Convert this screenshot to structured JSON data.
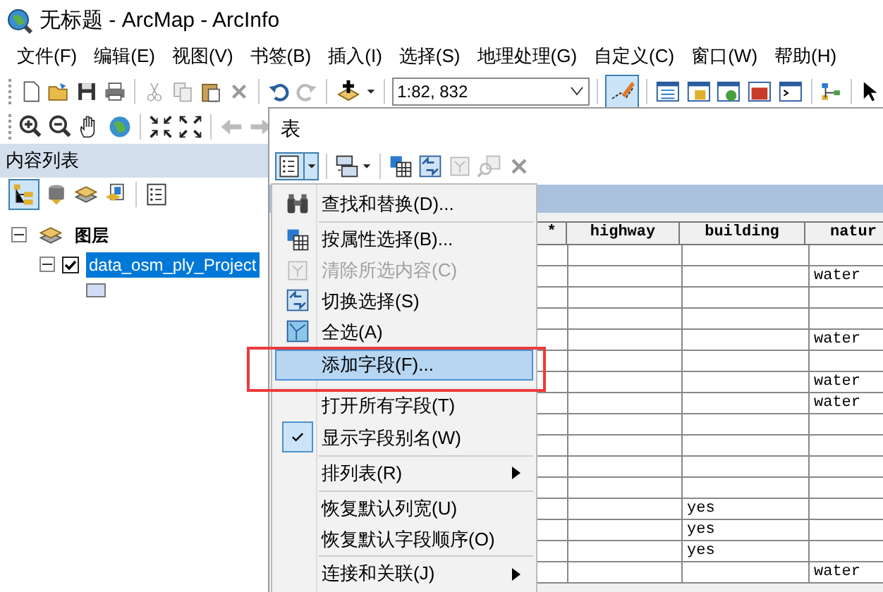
{
  "window": {
    "title": "无标题 - ArcMap - ArcInfo"
  },
  "menu_bar": [
    "文件(F)",
    "编辑(E)",
    "视图(V)",
    "书签(B)",
    "插入(I)",
    "选择(S)",
    "地理处理(G)",
    "自定义(C)",
    "窗口(W)",
    "帮助(H)"
  ],
  "toolbar": {
    "scale": "1:82, 832"
  },
  "table_of_contents": {
    "title": "内容列表",
    "tree": [
      {
        "label": "图层",
        "expanded": true,
        "children": [
          {
            "label": "data_osm_ply_Project",
            "checked": true,
            "selected": true,
            "expanded": true
          }
        ]
      }
    ]
  },
  "table_window": {
    "title": "表",
    "columns": [
      "*",
      "highway",
      "building",
      "natur"
    ],
    "rows": [
      {
        "cells": [
          null,
          null,
          null,
          null
        ]
      },
      {
        "cells": [
          null,
          null,
          null,
          "water"
        ]
      },
      {
        "cells": [
          null,
          null,
          null,
          null
        ]
      },
      {
        "cells": [
          null,
          null,
          null,
          null
        ]
      },
      {
        "cells": [
          null,
          null,
          null,
          "water"
        ]
      },
      {
        "cells": [
          null,
          null,
          null,
          null
        ]
      },
      {
        "cells": [
          null,
          null,
          null,
          "water"
        ]
      },
      {
        "cells": [
          null,
          null,
          null,
          "water"
        ]
      },
      {
        "cells": [
          null,
          null,
          null,
          null
        ]
      },
      {
        "cells": [
          null,
          null,
          null,
          null
        ]
      },
      {
        "cells": [
          null,
          null,
          null,
          null
        ]
      },
      {
        "cells": [
          null,
          null,
          null,
          null
        ]
      },
      {
        "cells": [
          null,
          null,
          "yes",
          null
        ]
      },
      {
        "cells": [
          null,
          null,
          "yes",
          null
        ]
      },
      {
        "cells": [
          null,
          null,
          "yes",
          null
        ]
      },
      {
        "cells": [
          null,
          null,
          null,
          "water"
        ]
      }
    ]
  },
  "context_menu": [
    {
      "kind": "item",
      "label": "查找和替换(D)...",
      "disabled": false,
      "checked": false,
      "submenu": false,
      "selected": false
    },
    {
      "kind": "separator"
    },
    {
      "kind": "item",
      "label": "按属性选择(B)...",
      "disabled": false,
      "checked": false,
      "submenu": false,
      "selected": false
    },
    {
      "kind": "item",
      "label": "清除所选内容(C)",
      "disabled": true,
      "checked": false,
      "submenu": false,
      "selected": false
    },
    {
      "kind": "item",
      "label": "切换选择(S)",
      "disabled": false,
      "checked": false,
      "submenu": false,
      "selected": false
    },
    {
      "kind": "item",
      "label": "全选(A)",
      "disabled": false,
      "checked": false,
      "submenu": false,
      "selected": false
    },
    {
      "kind": "item",
      "label": "添加字段(F)...",
      "disabled": false,
      "checked": false,
      "submenu": false,
      "selected": true
    },
    {
      "kind": "item",
      "label": "打开所有字段(T)",
      "disabled": false,
      "checked": false,
      "submenu": false,
      "selected": false
    },
    {
      "kind": "item",
      "label": "显示字段别名(W)",
      "disabled": false,
      "checked": true,
      "submenu": false,
      "selected": false
    },
    {
      "kind": "separator"
    },
    {
      "kind": "item",
      "label": "排列表(R)",
      "disabled": false,
      "checked": false,
      "submenu": true,
      "selected": false
    },
    {
      "kind": "separator"
    },
    {
      "kind": "item",
      "label": "恢复默认列宽(U)",
      "disabled": false,
      "checked": false,
      "submenu": false,
      "selected": false
    },
    {
      "kind": "item",
      "label": "恢复默认字段顺序(O)",
      "disabled": false,
      "checked": false,
      "submenu": false,
      "selected": false
    },
    {
      "kind": "separator"
    },
    {
      "kind": "item",
      "label": "连接和关联(J)",
      "disabled": false,
      "checked": false,
      "submenu": true,
      "selected": false
    }
  ]
}
